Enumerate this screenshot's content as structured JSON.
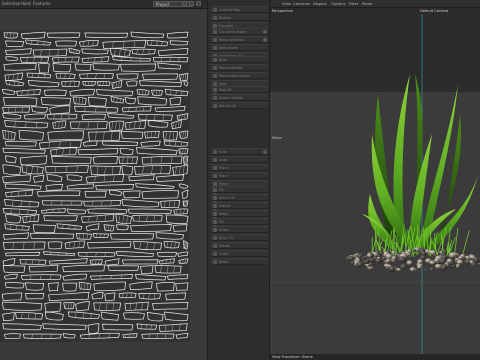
{
  "uv_menu": {
    "items": [
      "Selection",
      "Hard",
      "Features"
    ]
  },
  "palette": {
    "mode_value": "Project",
    "groups": [
      [
        "Optimal Map",
        "Realign",
        "Equalize"
      ],
      [
        "Cut along edges",
        "Relax selection",
        "Edit seams",
        "Straighten UV"
      ],
      [
        "Align",
        "Pack selected",
        "Pack shape match",
        "Split",
        "Transform"
      ],
      [
        "Map All",
        "Smart Unwrap",
        "Rotate UV"
      ],
      [
        "Grid",
        "Snap",
        "Flip U",
        "Flip V",
        "Mirror",
        "UV Projection",
        "Weld selected",
        "Sew seams",
        "Unweld",
        "Stitch"
      ],
      [
        "Fill",
        "Mirror UV",
        "Distort",
        "Relax",
        "Pin",
        "Unpin",
        "Align UV",
        "Rotate",
        "Scale",
        "Reset"
      ]
    ]
  },
  "viewport": {
    "menu": [
      "View",
      "Cameras",
      "Display",
      "Options",
      "Filter",
      "Panel"
    ],
    "projection_label": "Perspective",
    "camera_label": "Default Camera",
    "axis_label": "Mirror",
    "footer_label": "View Transform: Scene"
  },
  "colors": {
    "panel_bg": "#2b2b2b",
    "uv_grid_bg": "#3a3a3a",
    "uv_line": "#e6e6e6",
    "plant_green": "#5fae22",
    "plant_dark": "#2f6a10",
    "guide_cyan": "#3aa6a6"
  },
  "icons": {
    "palette_top": [
      "undo-icon",
      "redo-icon",
      "grid-icon"
    ],
    "tool_row": "tool-icon",
    "tool_flag": "circle-icon"
  }
}
